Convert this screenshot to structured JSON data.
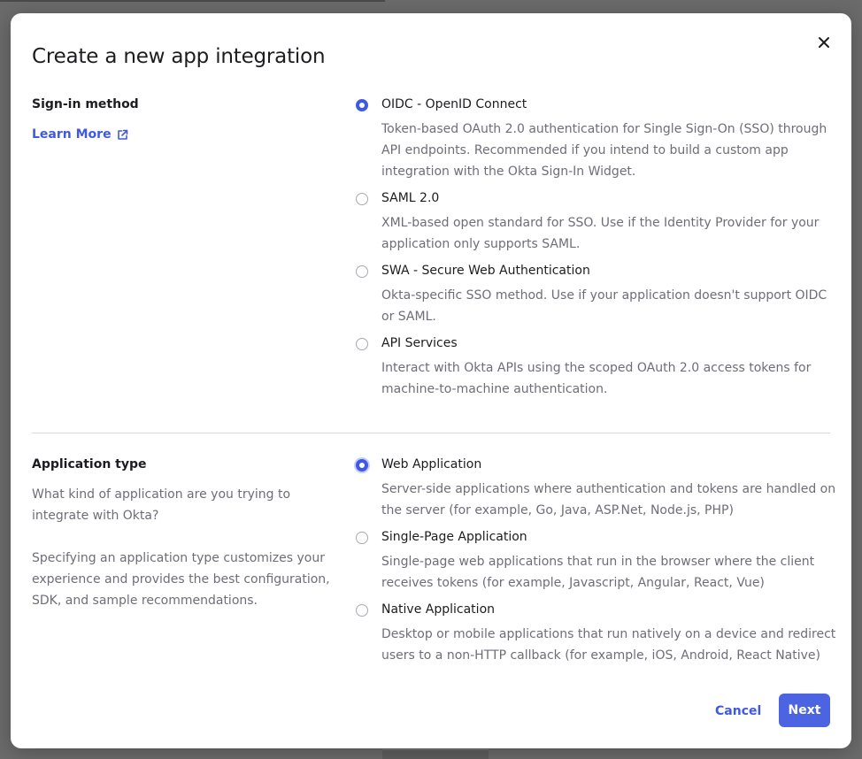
{
  "modal": {
    "title": "Create a new app integration",
    "close_label": "×"
  },
  "sign_in": {
    "label": "Sign-in method",
    "learn_more": "Learn More",
    "options": [
      {
        "label": "OIDC - OpenID Connect",
        "description": "Token-based OAuth 2.0 authentication for Single Sign-On (SSO) through API endpoints. Recommended if you intend to build a custom app integration with the Okta Sign-In Widget.",
        "selected": true
      },
      {
        "label": "SAML 2.0",
        "description": "XML-based open standard for SSO. Use if the Identity Provider for your application only supports SAML.",
        "selected": false
      },
      {
        "label": "SWA - Secure Web Authentication",
        "description": "Okta-specific SSO method. Use if your application doesn't support OIDC or SAML.",
        "selected": false
      },
      {
        "label": "API Services",
        "description": "Interact with Okta APIs using the scoped OAuth 2.0 access tokens for machine-to-machine authentication.",
        "selected": false
      }
    ]
  },
  "app_type": {
    "label": "Application type",
    "help_1": "What kind of application are you trying to integrate with Okta?",
    "help_2": "Specifying an application type customizes your experience and provides the best configuration, SDK, and sample recommendations.",
    "options": [
      {
        "label": "Web Application",
        "description": "Server-side applications where authentication and tokens are handled on the server (for example, Go, Java, ASP.Net, Node.js, PHP)",
        "selected": true
      },
      {
        "label": "Single-Page Application",
        "description": "Single-page web applications that run in the browser where the client receives tokens (for example, Javascript, Angular, React, Vue)",
        "selected": false
      },
      {
        "label": "Native Application",
        "description": "Desktop or mobile applications that run natively on a device and redirect users to a non-HTTP callback (for example, iOS, Android, React Native)",
        "selected": false
      }
    ]
  },
  "footer": {
    "cancel_label": "Cancel",
    "next_label": "Next"
  },
  "colors": {
    "accent": "#3f59e4",
    "primary_button": "#4c64e1",
    "text_primary": "#1d1d21",
    "text_secondary": "#6e6e78"
  },
  "icons": {
    "close": "close-icon",
    "external_link": "external-link-icon"
  }
}
